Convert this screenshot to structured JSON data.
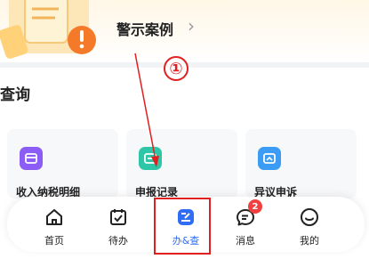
{
  "banner": {
    "title": "警示案例",
    "chevron": "›"
  },
  "marker": "①",
  "section": {
    "title": "查询"
  },
  "cards": [
    {
      "label": "收入纳税明细",
      "icon": "income-detail-icon",
      "color": "#8b5cf6"
    },
    {
      "label": "申报记录",
      "icon": "declaration-record-icon",
      "color": "#2dc7a8"
    },
    {
      "label": "异议申诉",
      "icon": "objection-appeal-icon",
      "color": "#3b9cf5"
    }
  ],
  "tabbar": {
    "tabs": [
      {
        "label": "首页",
        "icon": "home-icon"
      },
      {
        "label": "待办",
        "icon": "todo-icon"
      },
      {
        "label": "办&查",
        "icon": "process-query-icon",
        "active": true
      },
      {
        "label": "消息",
        "icon": "message-icon",
        "badge": "2"
      },
      {
        "label": "我的",
        "icon": "profile-icon"
      }
    ]
  },
  "colors": {
    "accent": "#2f6df6",
    "annotation": "#e02020",
    "badge": "#f04040"
  }
}
